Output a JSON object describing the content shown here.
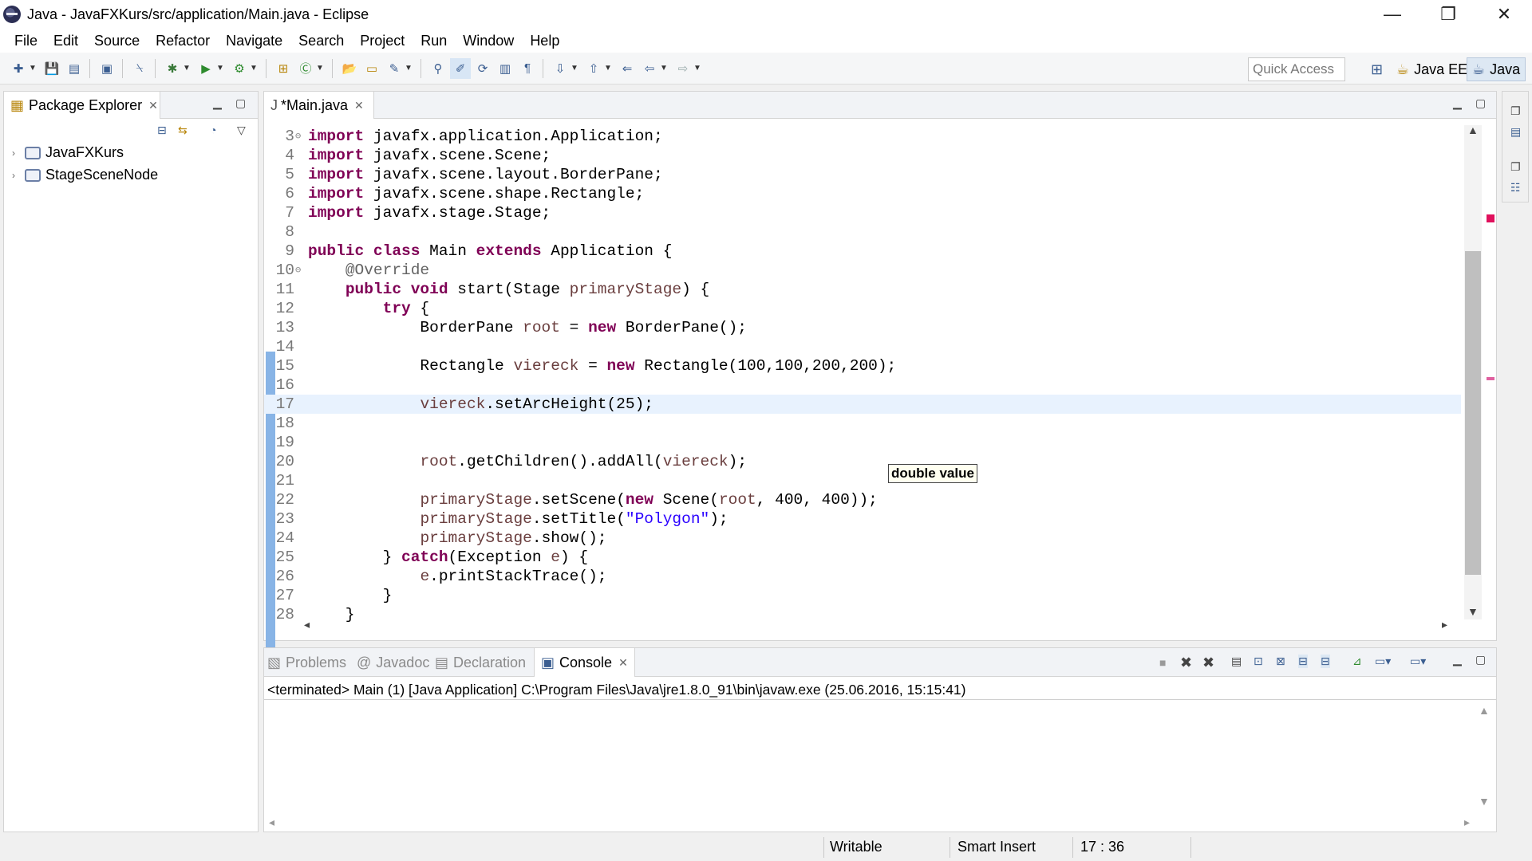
{
  "window": {
    "title": "Java - JavaFXKurs/src/application/Main.java - Eclipse",
    "controls": {
      "minimize": "—",
      "restore": "❐",
      "close": "✕"
    }
  },
  "menu": [
    "File",
    "Edit",
    "Source",
    "Refactor",
    "Navigate",
    "Search",
    "Project",
    "Run",
    "Window",
    "Help"
  ],
  "toolbar": {
    "quick_access_placeholder": "Quick Access",
    "perspectives": [
      "Java EE",
      "Java"
    ]
  },
  "package_explorer": {
    "tab_label": "Package Explorer",
    "projects": [
      "JavaFXKurs",
      "StageSceneNode"
    ]
  },
  "editor": {
    "tab_label": "*Main.java",
    "lines": [
      {
        "n": "3",
        "fold": "⊖",
        "html": "import javafx.application.Application;"
      },
      {
        "n": "4",
        "html": "import javafx.scene.Scene;"
      },
      {
        "n": "5",
        "html": "import javafx.scene.layout.BorderPane;"
      },
      {
        "n": "6",
        "html": "import javafx.scene.shape.Rectangle;"
      },
      {
        "n": "7",
        "html": "import javafx.stage.Stage;"
      },
      {
        "n": "8",
        "html": ""
      },
      {
        "n": "9",
        "html": "public class Main extends Application {"
      },
      {
        "n": "10",
        "fold": "⊖",
        "html": "    @Override"
      },
      {
        "n": "11",
        "html": "    public void start(Stage primaryStage) {"
      },
      {
        "n": "12",
        "html": "        try {"
      },
      {
        "n": "13",
        "html": "            BorderPane root = new BorderPane();"
      },
      {
        "n": "14",
        "html": ""
      },
      {
        "n": "15",
        "html": "            Rectangle viereck = new Rectangle(100,100,200,200);"
      },
      {
        "n": "16",
        "html": ""
      },
      {
        "n": "17",
        "html": "            viereck.setArcHeight(25);"
      },
      {
        "n": "18",
        "html": ""
      },
      {
        "n": "19",
        "html": ""
      },
      {
        "n": "20",
        "html": "            root.getChildren().addAll(viereck);"
      },
      {
        "n": "21",
        "html": ""
      },
      {
        "n": "22",
        "html": "            primaryStage.setScene(new Scene(root, 400, 400));"
      },
      {
        "n": "23",
        "html": "            primaryStage.setTitle(\"Polygon\");"
      },
      {
        "n": "24",
        "html": "            primaryStage.show();"
      },
      {
        "n": "25",
        "html": "        } catch(Exception e) {"
      },
      {
        "n": "26",
        "html": "            e.printStackTrace();"
      },
      {
        "n": "27",
        "html": "        }"
      },
      {
        "n": "28",
        "html": "    }"
      }
    ],
    "tooltip": "double value"
  },
  "console": {
    "tabs": [
      "Problems",
      "Javadoc",
      "Declaration",
      "Console"
    ],
    "status": "<terminated> Main (1) [Java Application] C:\\Program Files\\Java\\jre1.8.0_91\\bin\\javaw.exe (25.06.2016, 15:15:41)"
  },
  "statusbar": {
    "mode": "Writable",
    "insert": "Smart Insert",
    "position": "17 : 36"
  }
}
